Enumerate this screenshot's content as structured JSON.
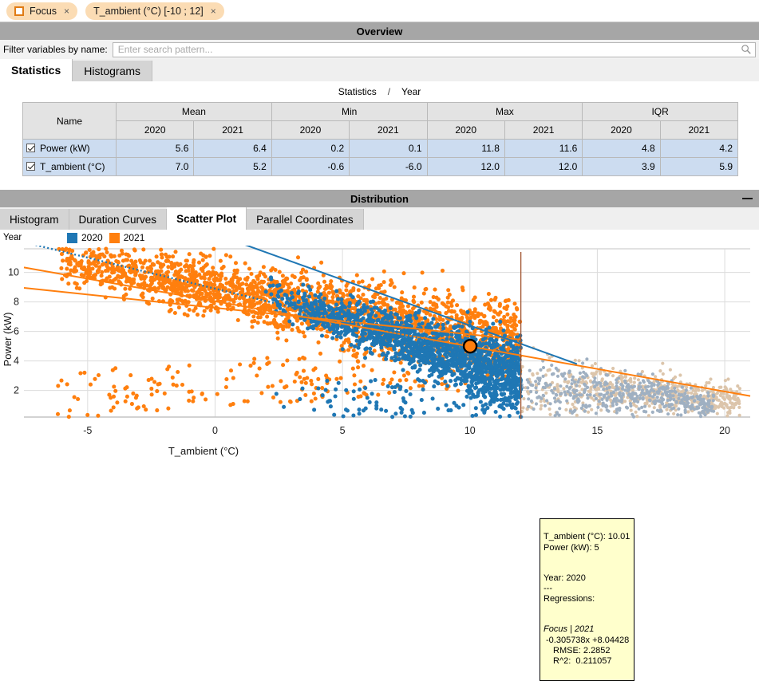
{
  "chips": [
    {
      "label": "Focus",
      "icon": "orange-square-icon",
      "close": "×",
      "has_square": true
    },
    {
      "label": "T_ambient (°C) [-10 ; 12]",
      "close": "×",
      "has_square": false
    }
  ],
  "overview": {
    "title": "Overview",
    "filter_label": "Filter variables by name:",
    "search_placeholder": "Enter search pattern...",
    "search_value": "",
    "tabs": [
      {
        "label": "Statistics",
        "active": true
      },
      {
        "label": "Histograms",
        "active": false
      }
    ],
    "stats_heading": {
      "left": "Statistics",
      "sep": "/",
      "right": "Year"
    },
    "table": {
      "name_header": "Name",
      "group_headers": [
        "Mean",
        "Min",
        "Max",
        "IQR"
      ],
      "year_headers": [
        "2020",
        "2021",
        "2020",
        "2021",
        "2020",
        "2021",
        "2020",
        "2021"
      ],
      "rows": [
        {
          "checked": true,
          "name": "Power (kW)",
          "values": [
            "5.6",
            "6.4",
            "0.2",
            "0.1",
            "11.8",
            "11.6",
            "4.8",
            "4.2"
          ]
        },
        {
          "checked": true,
          "name": "T_ambient (°C)",
          "values": [
            "7.0",
            "5.2",
            "-0.6",
            "-6.0",
            "12.0",
            "12.0",
            "3.9",
            "5.9"
          ]
        }
      ]
    }
  },
  "distribution": {
    "title": "Distribution",
    "minimize": "minimize-icon",
    "tabs": [
      {
        "label": "Histogram",
        "active": false
      },
      {
        "label": "Duration Curves",
        "active": false
      },
      {
        "label": "Scatter Plot",
        "active": true
      },
      {
        "label": "Parallel Coordinates",
        "active": false
      }
    ],
    "legend": {
      "title": "Year",
      "items": [
        {
          "label": "2020",
          "color": "#1f77b4"
        },
        {
          "label": "2021",
          "color": "#ff7f0e"
        }
      ]
    }
  },
  "tooltip": {
    "line1": "T_ambient (°C): 10.01",
    "line2": "Power (kW): 5",
    "line3": "",
    "line4": "Year: 2020",
    "line5": "---",
    "line6": "Regressions:",
    "line7": "",
    "line8": "Focus | 2021",
    "line9": "-0.305738x +8.04428",
    "line10": "RMSE: 2.2852",
    "line11": "R^2:  0.211057"
  },
  "chart_data": {
    "type": "scatter",
    "title": "",
    "xlabel": "T_ambient (°C)",
    "ylabel": "Power (kW)",
    "xlim": [
      -7.5,
      21.0
    ],
    "ylim": [
      0.2,
      11.6
    ],
    "xticks": [
      -5,
      0,
      5,
      10,
      15,
      20
    ],
    "yticks": [
      2,
      4,
      6,
      8,
      10
    ],
    "grid": true,
    "legend_position": "top-left",
    "series": [
      {
        "name": "2020",
        "color": "#1f77b4",
        "n_points": 1700,
        "x_range": [
          2.0,
          12.0
        ],
        "y_range": [
          0.2,
          11.8
        ],
        "cluster_center": [
          9.0,
          4.3
        ],
        "note": "blue cloud, denser right/low"
      },
      {
        "name": "2021",
        "color": "#ff7f0e",
        "n_points": 2300,
        "x_range": [
          -6.0,
          12.0
        ],
        "y_range": [
          0.1,
          11.6
        ],
        "cluster_center": [
          5.0,
          6.0
        ],
        "note": "orange cloud, broad"
      },
      {
        "name": "outside-focus-2020",
        "color": "#9fb0c2",
        "n_points": 420,
        "x_range": [
          12.0,
          20.0
        ],
        "y_range": [
          0.5,
          4.0
        ],
        "faded": true
      },
      {
        "name": "outside-focus-2021",
        "color": "#dcc5ab",
        "n_points": 520,
        "x_range": [
          12.0,
          20.5
        ],
        "y_range": [
          0.5,
          4.5
        ],
        "faded": true
      }
    ],
    "regression_lines": [
      {
        "name": "Focus | 2021",
        "color": "#ff7f0e",
        "slope": -0.305738,
        "intercept": 8.04428,
        "rmse": 2.2852,
        "r2": 0.211057,
        "x_from": -7.5,
        "x_to": 21.0
      },
      {
        "name": "Focus | 2020",
        "color": "#ff7f0e",
        "slope": -0.18,
        "intercept": 7.6,
        "x_from": -7.5,
        "x_to": 12.0
      },
      {
        "name": "All | 2020",
        "color": "#1f77b4",
        "slope": -0.62,
        "intercept": 12.6,
        "x_from": 1.0,
        "x_to": 14.2
      },
      {
        "name": "dotted | 2020",
        "color": "#1f77b4",
        "dashed": true,
        "slope": -0.42,
        "intercept": 8.9,
        "x_from": -7.5,
        "x_to": 12.0
      }
    ],
    "highlighted_point": {
      "x": 10.01,
      "y": 5,
      "color": "#ff7f0e",
      "outline": "#000000",
      "radius": 8
    },
    "focus_bounds": {
      "x_min": -10,
      "x_max": 12,
      "color": "#a0522d"
    }
  }
}
